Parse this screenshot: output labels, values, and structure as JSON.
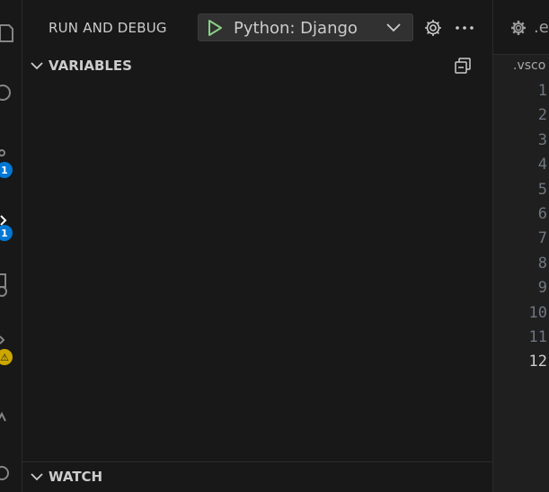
{
  "activity_bar": {
    "badges": {
      "source_control": "1",
      "run_debug": "1",
      "warning": "⚠"
    }
  },
  "sidebar": {
    "title": "RUN AND DEBUG",
    "launch_config": "Python: Django",
    "sections": {
      "variables": "VARIABLES",
      "watch": "WATCH"
    }
  },
  "editor": {
    "tab_label": ".e",
    "breadcrumb": ".vsco",
    "line_numbers": [
      "1",
      "2",
      "3",
      "4",
      "5",
      "6",
      "7",
      "8",
      "9",
      "10",
      "11",
      "12"
    ],
    "active_line": "12"
  },
  "colors": {
    "accent": "#0078d4",
    "warning": "#cca700",
    "play_green": "#89d185"
  }
}
